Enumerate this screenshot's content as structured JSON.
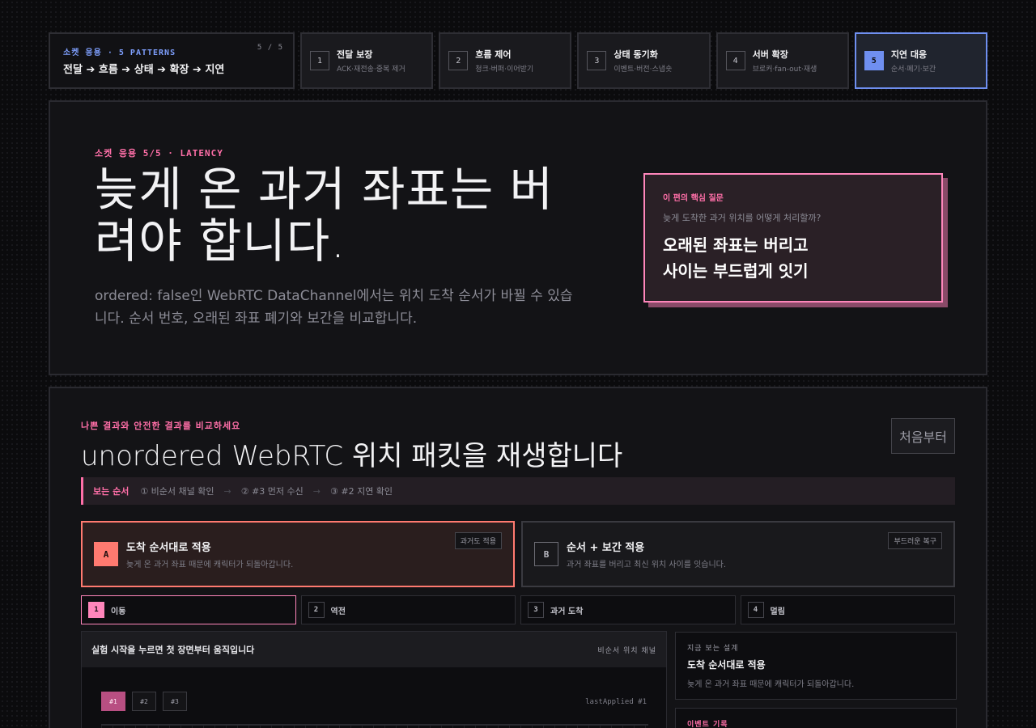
{
  "series": {
    "kicker": "소켓 응용 · 5 PATTERNS",
    "count": "5 / 5",
    "flow": "전달 ➔ 흐름 ➔ 상태 ➔ 확장 ➔ 지연"
  },
  "steps": [
    {
      "num": "1",
      "title": "전달 보장",
      "sub": "ACK·재전송·중복 제거"
    },
    {
      "num": "2",
      "title": "흐름 제어",
      "sub": "청크·버퍼·이어받기"
    },
    {
      "num": "3",
      "title": "상태 동기화",
      "sub": "이벤트·버전·스냅숏"
    },
    {
      "num": "4",
      "title": "서버 확장",
      "sub": "브로커·fan-out·재생"
    },
    {
      "num": "5",
      "title": "지연 대응",
      "sub": "순서·폐기·보간",
      "active": true
    }
  ],
  "hero": {
    "kicker": "소켓 응용 5/5 · LATENCY",
    "title": "늦게 온 과거 좌표는 버려야 합니다.",
    "description": "ordered: false인 WebRTC DataChannel에서는 위치 도착 순서가 바뀔 수 있습니다. 순서 번호, 오래된 좌표 폐기와 보간을 비교합니다."
  },
  "question": {
    "kicker": "이 편의 핵심 질문",
    "sub": "늦게 도착한 과거 위치를 어떻게 처리할까?",
    "answer_line1": "오래된 좌표는 버리고",
    "answer_line2": "사이는 부드럽게 잇기"
  },
  "playground": {
    "kicker": "나쁜 결과와 안전한 결과를 비교하세요",
    "title": "unordered WebRTC 위치 패킷을 재생합니다",
    "reset_label": "처음부터"
  },
  "guide": {
    "label": "보는 순서",
    "steps": [
      "① 비순서 채널 확인",
      "② #3 먼저 수신",
      "③ #2 지연 확인"
    ]
  },
  "modes": [
    {
      "badge": "A",
      "title": "도착 순서대로 적용",
      "desc": "늦게 온 과거 좌표 때문에 캐릭터가 되돌아갑니다.",
      "tag": "과거도 적용"
    },
    {
      "badge": "B",
      "title": "순서 + 보간 적용",
      "desc": "과거 좌표를 버리고 최신 위치 사이를 잇습니다.",
      "tag": "부드러운 복구"
    }
  ],
  "tabs": [
    {
      "num": "1",
      "label": "이동",
      "active": true
    },
    {
      "num": "2",
      "label": "역전"
    },
    {
      "num": "3",
      "label": "과거 도착"
    },
    {
      "num": "4",
      "label": "멀림"
    }
  ],
  "stage": {
    "hint": "실험 시작을 누르면 첫 장면부터 움직입니다",
    "channel": "비순서 위치 채널",
    "packets": [
      {
        "label": "#1",
        "on": true
      },
      {
        "label": "#2"
      },
      {
        "label": "#3"
      }
    ],
    "last_applied": "lastApplied #1"
  },
  "current_design": {
    "kicker": "지금 보는 설계",
    "title": "도착 순서대로 적용",
    "desc": "늦게 온 과거 좌표 때문에 캐릭터가 되돌아갑니다."
  },
  "event_log": {
    "kicker": "이벤트 기록"
  }
}
